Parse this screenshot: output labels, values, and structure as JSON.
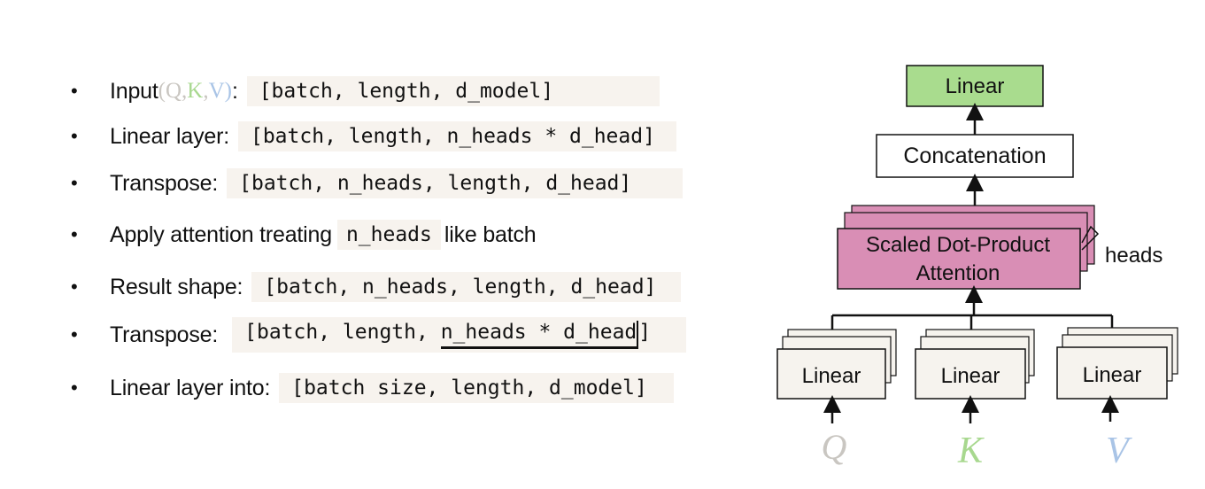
{
  "bullets": [
    {
      "label": "Input",
      "qkv": {
        "open": "(",
        "q": "Q",
        "k": "K",
        "v": "V",
        "close": ")",
        "colon": ":"
      },
      "code": "[batch, length, d_model]"
    },
    {
      "label": "Linear layer:",
      "code": "[batch, length, n_heads * d_head]"
    },
    {
      "label": "Transpose:",
      "code": "[batch, n_heads, length, d_head]"
    },
    {
      "label_before": "Apply attention treating",
      "code": "n_heads",
      "label_after": "like batch"
    },
    {
      "label": "Result shape:",
      "code": "[batch, n_heads, length, d_head]"
    },
    {
      "label": "Transpose:",
      "code_prefix": "[batch, length, ",
      "code_underlined": "n_heads * d_head",
      "code_suffix": "]"
    },
    {
      "label": "Linear layer into:",
      "code": "[batch size, length, d_model]"
    }
  ],
  "bullet_symbol": "•",
  "diagram": {
    "top_linear": "Linear",
    "concat": "Concatenation",
    "attention_line1": "Scaled Dot-Product",
    "attention_line2": "Attention",
    "heads": "heads",
    "linear_q": "Linear",
    "linear_k": "Linear",
    "linear_v": "Linear",
    "input_q": "Q",
    "input_k": "K",
    "input_v": "V"
  },
  "colors": {
    "q": "#c9c6c1",
    "k": "#a8d88f",
    "v": "#a9c4e6",
    "top_linear_fill": "#a9dc8e",
    "attention_fill": "#d98eb5",
    "linear_fill": "#f6f3ee",
    "code_bg": "#f7f3ee"
  }
}
